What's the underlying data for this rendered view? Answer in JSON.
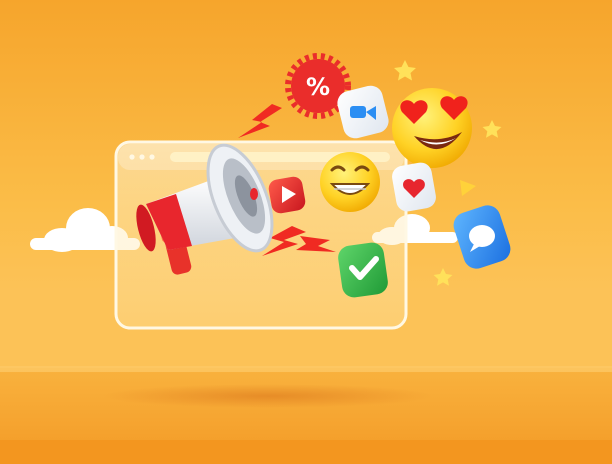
{
  "scene": {
    "background_top": "#f7a92f",
    "background_mid": "#fbbf4a",
    "floor": "#f4a12d",
    "accent_orange": "#f58c1f",
    "accent_red": "#e7262e",
    "accent_blue": "#2b8ef3",
    "accent_green": "#2fb54b",
    "accent_yellow": "#ffd23a"
  },
  "icons": {
    "megaphone": "megaphone-icon",
    "percent_badge": "percent-badge-icon",
    "percent_symbol": "%",
    "video": "video-camera-icon",
    "heart_eyes": "heart-eyes-emoji-icon",
    "grinning": "grinning-emoji-icon",
    "heart": "heart-icon",
    "chat": "chat-bubble-icon",
    "check": "checkmark-icon",
    "play": "play-icon",
    "lightning": "lightning-bolt-icon",
    "star": "star-icon",
    "cloud": "cloud-icon"
  }
}
